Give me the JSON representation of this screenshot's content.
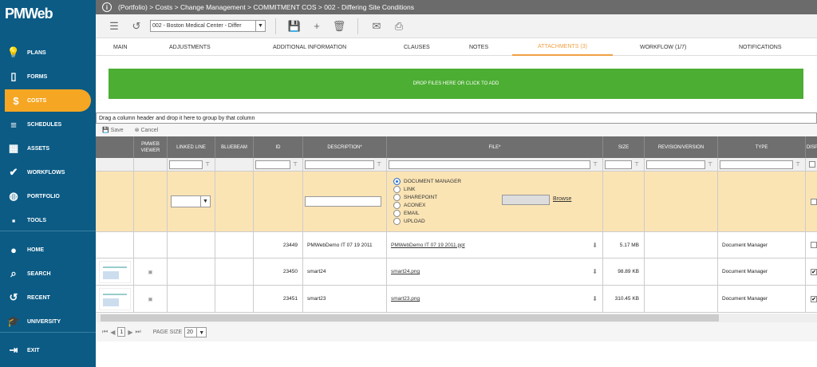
{
  "app": {
    "logo": "PMWeb"
  },
  "sidebar": {
    "items": [
      {
        "label": "PLANS",
        "icon": "lightbulb-icon"
      },
      {
        "label": "FORMS",
        "icon": "form-icon"
      },
      {
        "label": "COSTS",
        "icon": "dollar-icon"
      },
      {
        "label": "SCHEDULES",
        "icon": "schedule-icon"
      },
      {
        "label": "ASSETS",
        "icon": "building-icon"
      },
      {
        "label": "WORKFLOWS",
        "icon": "check-icon"
      },
      {
        "label": "PORTFOLIO",
        "icon": "globe-icon"
      },
      {
        "label": "TOOLS",
        "icon": "briefcase-icon"
      },
      {
        "label": "HOME",
        "icon": "home-avatar-icon"
      },
      {
        "label": "SEARCH",
        "icon": "search-icon"
      },
      {
        "label": "RECENT",
        "icon": "history-icon"
      },
      {
        "label": "UNIVERSITY",
        "icon": "graduation-cap-icon"
      },
      {
        "label": "EXIT",
        "icon": "exit-icon"
      }
    ],
    "active": "COSTS",
    "accent": "#f5a623",
    "bg": "#0b5b85"
  },
  "breadcrumb": "(Portfolio) > Costs > Change Management > COMMITMENT COS > 002 - Differing Site Conditions",
  "toolbar": {
    "project_select": "002 - Boston Medical Center - Differ"
  },
  "tabs": [
    "MAIN",
    "ADJUSTMENTS",
    "ADDITIONAL INFORMATION",
    "CLAUSES",
    "NOTES",
    "ATTACHMENTS (3)",
    "WORKFLOW (1/7)",
    "NOTIFICATIONS"
  ],
  "active_tab": "ATTACHMENTS (3)",
  "dropzone": {
    "label": "DROP FILES HERE OR CLICK TO ADD",
    "color": "#4cae33"
  },
  "grid": {
    "group_hint": "Drag a column header and drop it here to group by that column",
    "save_label": "Save",
    "cancel_label": "Cancel",
    "columns": [
      "",
      "PMWEB VIEWER",
      "LINKED LINE",
      "BLUEBEAM",
      "ID",
      "DESCRIPTION*",
      "FILE*",
      "SIZE",
      "REVISION/VERSION",
      "TYPE",
      "DISPL"
    ],
    "edit_row": {
      "options": [
        "DOCUMENT MANAGER",
        "LINK",
        "SHAREPOINT",
        "ACONEX",
        "EMAIL",
        "UPLOAD"
      ],
      "selected": "DOCUMENT MANAGER",
      "browse": "Browse"
    },
    "rows": [
      {
        "id": "23449",
        "description": "PMWebDemo IT 07 19 2011",
        "file": "PMWebDemo IT 07 19 2011.ppt",
        "size": "5.17 MB",
        "revision": "",
        "type": "Document Manager",
        "display": false,
        "thumb": false
      },
      {
        "id": "23450",
        "description": "smart24",
        "file": "smart24.png",
        "size": "98.89 KB",
        "revision": "",
        "type": "Document Manager",
        "display": true,
        "thumb": true
      },
      {
        "id": "23451",
        "description": "smart23",
        "file": "smart23.png",
        "size": "310.45 KB",
        "revision": "",
        "type": "Document Manager",
        "display": true,
        "thumb": true
      }
    ]
  },
  "pager": {
    "page": "1",
    "page_size_label": "PAGE SIZE",
    "page_size": "20"
  }
}
